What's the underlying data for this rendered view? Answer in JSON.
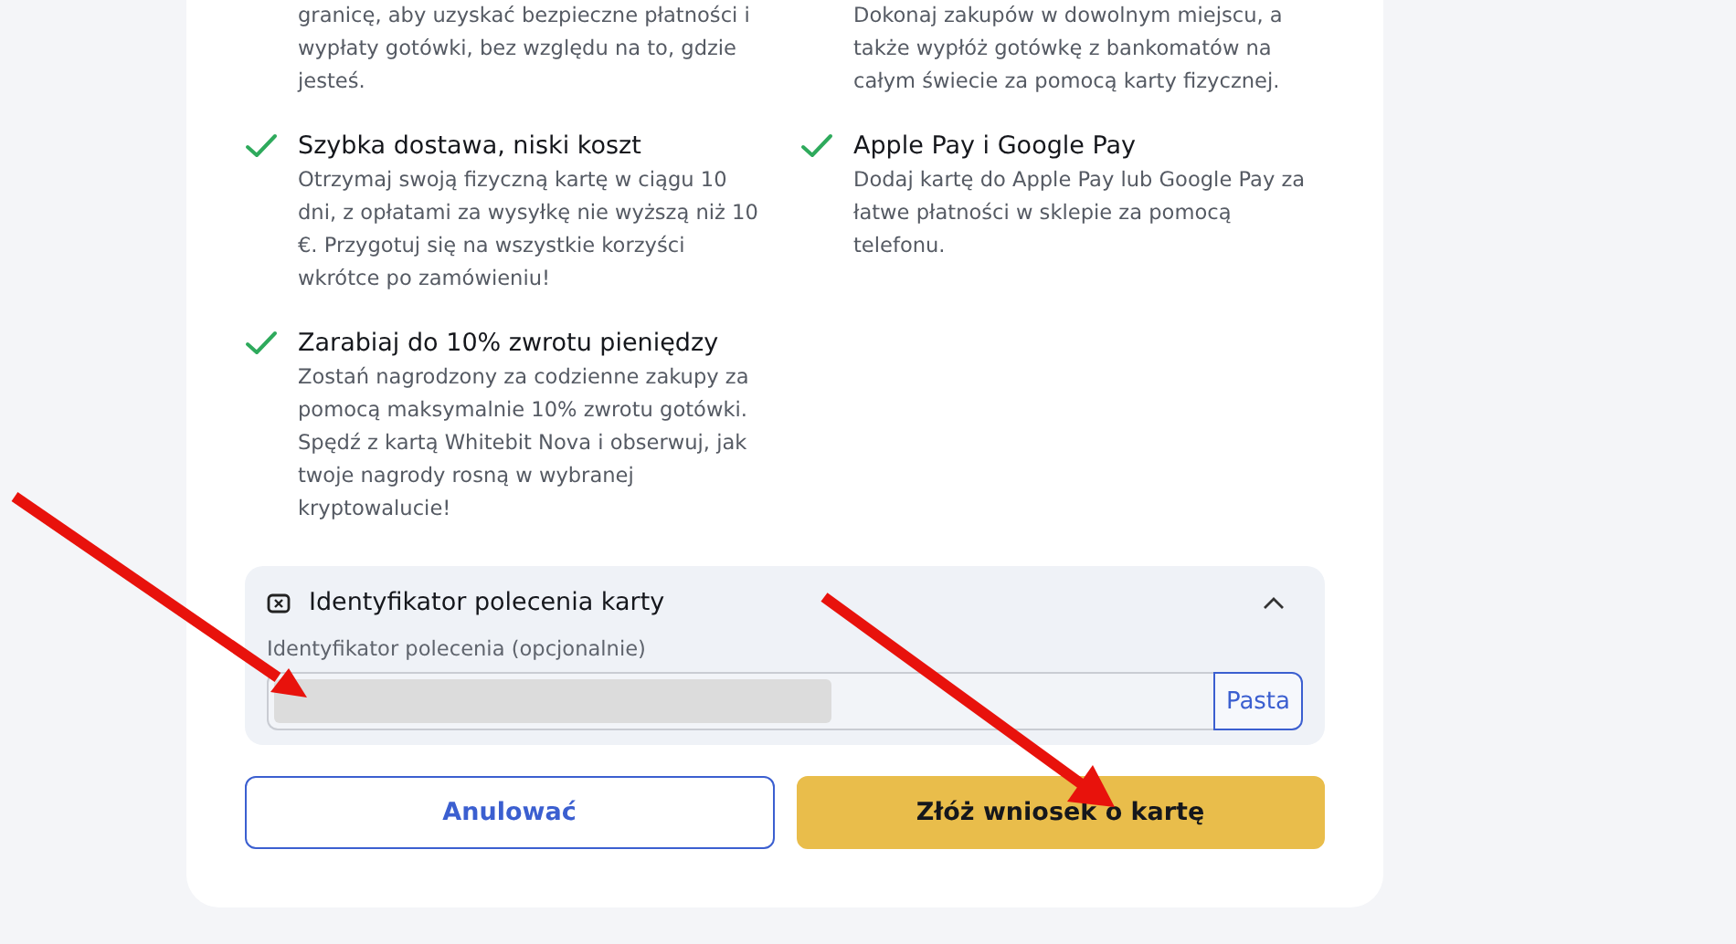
{
  "features": [
    {
      "description": "granicę, aby uzyskać bezpieczne płatności i wypłaty gotówki, bez względu na to, gdzie jesteś."
    },
    {
      "description": "Dokonaj zakupów w dowolnym miejscu, a także wypłóż gotówkę z bankomatów na całym świecie za pomocą karty fizycznej."
    },
    {
      "title": "Szybka dostawa, niski koszt",
      "description": "Otrzymaj swoją fizyczną kartę w ciągu 10 dni, z opłatami za wysyłkę nie wyższą niż 10 €. Przygotuj się na wszystkie korzyści wkrótce po zamówieniu!"
    },
    {
      "title": "Apple Pay i Google Pay",
      "description": "Dodaj kartę do Apple Pay lub Google Pay za łatwe płatności w sklepie za pomocą telefonu."
    },
    {
      "title": "Zarabiaj do 10% zwrotu pieniędzy",
      "description": "Zostań nagrodzony za codzienne zakupy za pomocą maksymalnie 10% zwrotu gotówki. Spędź z kartą Whitebit Nova i obserwuj, jak twoje nagrody rosną w wybranej kryptowalucie!"
    }
  ],
  "referral": {
    "title": "Identyfikator polecenia karty",
    "expanded": true,
    "field_label": "Identyfikator polecenia (opcjonalnie)",
    "paste_button": "Pasta"
  },
  "buttons": [
    {
      "label": "Anulować",
      "kind": "secondary"
    },
    {
      "label": "Złóż wniosek o kartę",
      "kind": "primary"
    }
  ]
}
